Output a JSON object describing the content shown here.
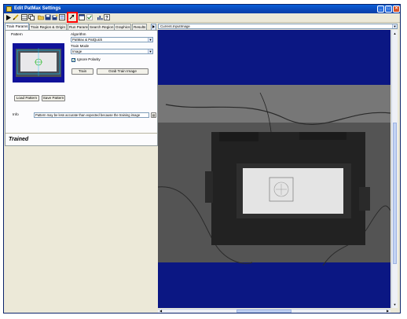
{
  "window": {
    "title": "Edit PatMax Settings"
  },
  "title_buttons": [
    "_",
    "□",
    "×"
  ],
  "tabs": [
    "Train Params",
    "Train Region & Origin",
    "Run Params",
    "Search Region",
    "Graphics",
    "Results"
  ],
  "train": {
    "pattern_label": "Pattern",
    "load_pattern": "Load Pattern",
    "save_pattern": "Save Pattern",
    "algorithm_label": "Algorithm",
    "algorithm_value": "PatMax & PatQuick",
    "train_mode_label": "Train Mode",
    "train_mode_value": "Image",
    "ignore_polarity_label": "Ignore Polarity",
    "ignore_polarity_checked": true,
    "train_button": "Train",
    "grab_train_image_button": "Grab Train Image",
    "info_label": "Info",
    "info_text": "Pattern may be less accurate than expected because the training image",
    "status": "Trained"
  },
  "display": {
    "image_selector": "Current.InputImage"
  },
  "colors": {
    "title_bar": "#0b48b8",
    "display_bg": "#0b1783",
    "highlight": "#ff0000"
  }
}
